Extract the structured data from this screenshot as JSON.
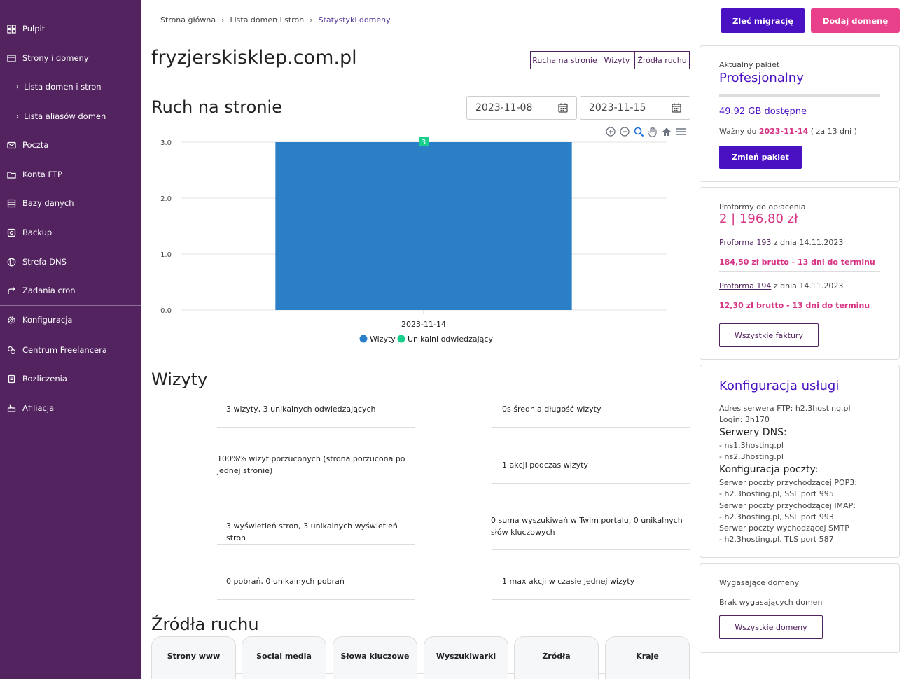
{
  "sidebar": {
    "items": [
      {
        "label": "Pulpit",
        "icon": "dashboard-icon"
      },
      {
        "label": "Strony i domeny",
        "icon": "sites-icon"
      },
      {
        "label": "Lista domen i stron",
        "sub": true
      },
      {
        "label": "Lista aliasów domen",
        "sub": true
      },
      {
        "label": "Poczta",
        "icon": "mail-icon"
      },
      {
        "label": "Konta FTP",
        "icon": "folder-icon"
      },
      {
        "label": "Bazy danych",
        "icon": "database-icon"
      },
      {
        "label": "Backup",
        "icon": "backup-icon"
      },
      {
        "label": "Strefa DNS",
        "icon": "globe-icon"
      },
      {
        "label": "Zadania cron",
        "icon": "cron-icon"
      },
      {
        "label": "Konfiguracja",
        "icon": "gear-icon"
      },
      {
        "label": "Centrum Freelancera",
        "icon": "freelancer-icon"
      },
      {
        "label": "Rozliczenia",
        "icon": "billing-icon"
      },
      {
        "label": "Afiliacja",
        "icon": "affiliate-icon"
      }
    ]
  },
  "breadcrumb": [
    "Strona główna",
    "Lista domen i stron",
    "Statystyki domeny"
  ],
  "header": {
    "migrate_label": "Zleć migrację",
    "add_domain_label": "Dodaj domenę"
  },
  "domain": "fryzjerskisklep.com.pl",
  "segments": [
    "Rucha na stronie",
    "Wizyty",
    "Źródła ruchu"
  ],
  "traffic": {
    "title": "Ruch na stronie",
    "date_from": "2023-11-08",
    "date_to": "2023-11-15"
  },
  "chart_data": {
    "type": "bar",
    "categories": [
      "2023-11-14"
    ],
    "series": [
      {
        "name": "Wizyty",
        "values": [
          3
        ],
        "color": "#2a7fc7"
      },
      {
        "name": "Unikalni odwiedzający",
        "values": [
          3
        ],
        "color": "#18d08c"
      }
    ],
    "yticks": [
      "0.0",
      "1.0",
      "2.0",
      "3.0"
    ],
    "ylim": [
      0,
      3
    ],
    "data_label": "3",
    "legend": "bottom"
  },
  "visits": {
    "title": "Wizyty",
    "stats": [
      "3 wizyty, 3 unikalnych odwiedzających",
      "0s średnia długość wizyty",
      "100%% wizyt porzuconych (strona porzucona po jednej stronie)",
      "1 akcji podczas wizyty",
      "3 wyświetleń stron, 3 unikalnych wyświetleń stron",
      "0 suma wyszukiwań w Twim portalu, 0 unikalnych słów kluczowych",
      "0 pobrań, 0 unikalnych pobrań",
      "1 max akcji w czasie jednej wizyty"
    ]
  },
  "sources": {
    "title": "Źródła ruchu",
    "tabs": [
      "Strony www",
      "Social media",
      "Słowa kluczowe",
      "Wyszukiwarki",
      "Źródła",
      "Kraje"
    ]
  },
  "package": {
    "label": "Aktualny pakiet",
    "name": "Profesjonalny",
    "available": "49.92 GB dostępne",
    "valid_prefix": "Ważny do",
    "valid_date": "2023-11-14",
    "valid_suffix": "( za 13 dni )",
    "change_label": "Zmień pakiet"
  },
  "proforma": {
    "label": "Proformy do opłacenia",
    "total": "2 | 196,80 zł",
    "items": [
      {
        "link": "Proforma 193",
        "date": "z dnia 14.11.2023",
        "amount": "184,50 zł brutto - 13 dni do terminu"
      },
      {
        "link": "Proforma 194",
        "date": "z dnia 14.11.2023",
        "amount": "12,30 zł brutto - 13 dni do terminu"
      }
    ],
    "all_label": "Wszystkie faktury"
  },
  "config": {
    "title": "Konfiguracja usługi",
    "ftp": "Adres serwera FTP: h2.3hosting.pl",
    "login": "Login: 3h170",
    "dns_title": "Serwery DNS:",
    "dns1": "- ns1.3hosting.pl",
    "dns2": "- ns2.3hosting.pl",
    "mail_title": "Konfiguracja poczty:",
    "pop3": "Serwer poczty przychodzącej POP3:",
    "pop3_val": "- h2.3hosting.pl, SSL port 995",
    "imap": "Serwer poczty przychodzącej IMAP:",
    "imap_val": "- h2.3hosting.pl, SSL port 993",
    "smtp": "Serwer poczty wychodzącej SMTP",
    "smtp_val": "- h2.3hosting.pl, TLS port 587"
  },
  "expiring": {
    "label": "Wygasające domeny",
    "none": "Brak wygasających domen",
    "all_label": "Wszystkie domeny"
  }
}
